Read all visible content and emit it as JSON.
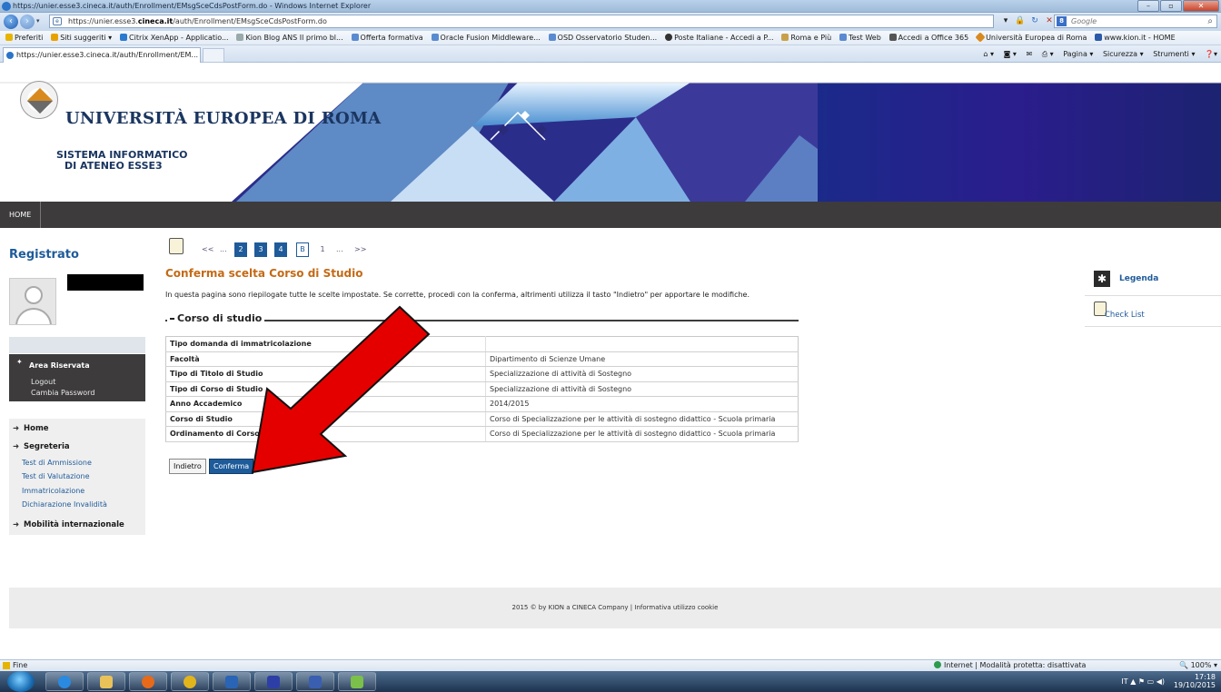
{
  "window": {
    "title": "https://unier.esse3.cineca.it/auth/Enrollment/EMsgSceCdsPostForm.do - Windows Internet Explorer",
    "buttons": [
      "–",
      "▫",
      "✕"
    ]
  },
  "address": {
    "url_prefix": "https://unier.esse3.",
    "url_host": "cineca.it",
    "url_rest": "/auth/Enrollment/EMsgSceCdsPostForm.do",
    "search_placeholder": "Google"
  },
  "favorites": {
    "label": "Preferiti",
    "items": [
      "Siti suggeriti ▾",
      "Citrix XenApp - Applicatio...",
      "Kion Blog ANS Il primo bl...",
      "Offerta formativa",
      "Oracle Fusion Middleware...",
      "OSD Osservatorio Studen...",
      "Poste Italiane - Accedi a P...",
      "Roma e Più",
      "Test Web",
      "Accedi a Office 365",
      "Università Europea di Roma",
      "www.kion.it - HOME"
    ]
  },
  "tab": {
    "label": "https://unier.esse3.cineca.it/auth/Enrollment/EM..."
  },
  "commandbar": {
    "items": [
      "Pagina ▾",
      "Sicurezza ▾",
      "Strumenti ▾"
    ]
  },
  "header": {
    "university": "UNIVERSITÀ EUROPEA DI ROMA",
    "system_line1": "SISTEMA INFORMATICO",
    "system_line2": "DI ATENEO ESSE3"
  },
  "topnav": {
    "home": "HOME"
  },
  "sidebar": {
    "registered": "Registrato",
    "area_title": "Area Riservata",
    "area_links": [
      "Logout",
      "Cambia Password"
    ],
    "menu": [
      {
        "label": "Home",
        "links": []
      },
      {
        "label": "Segreteria",
        "links": [
          "Test di Ammissione",
          "Test di Valutazione",
          "Immatricolazione",
          "Dichiarazione Invalidità"
        ]
      },
      {
        "label": "Mobilità internazionale",
        "links": []
      }
    ]
  },
  "steps": [
    "<<",
    "...",
    "2",
    "3",
    "4",
    "B",
    "1",
    "...",
    ">>"
  ],
  "main": {
    "title": "Conferma scelta Corso di Studio",
    "intro": "In questa pagina sono riepilogate tutte le scelte impostate. Se corrette, procedi con la conferma, altrimenti utilizza il tasto \"Indietro\" per apportare le modifiche.",
    "section": "Corso di studio",
    "rows": [
      {
        "key": "Tipo domanda di immatricolazione",
        "value": ""
      },
      {
        "key": "Facoltà",
        "value": "Dipartimento di Scienze Umane"
      },
      {
        "key": "Tipo di Titolo di Studio",
        "value": "Specializzazione di attività di Sostegno"
      },
      {
        "key": "Tipo di Corso di Studio",
        "value": "Specializzazione di attività di Sostegno"
      },
      {
        "key": "Anno Accademico",
        "value": "2014/2015"
      },
      {
        "key": "Corso di Studio",
        "value": "Corso di Specializzazione per le attività di sostegno didattico - Scuola primaria"
      },
      {
        "key": "Ordinamento di Corso",
        "value": "Corso di Specializzazione per le attività di sostegno didattico - Scuola primaria"
      }
    ],
    "back_label": "Indietro",
    "confirm_label": "Conferma"
  },
  "right": {
    "legenda": "Legenda",
    "checklist": "Check List"
  },
  "footer": {
    "text": "2015 © by KION a CINECA Company | Informativa utilizzo cookie"
  },
  "statusbar": {
    "status": "Fine",
    "zone": "Internet | Modalità protetta: disattivata",
    "zoom": "100%"
  },
  "tray": {
    "lang": "IT",
    "time": "17:18",
    "date": "19/10/2015"
  },
  "colors": {
    "accent_blue": "#1e5b9a",
    "title_orange": "#c46a16",
    "dark_bar": "#3d3b3b",
    "banner_navy": "#27208a",
    "arrow_red": "#e50000"
  }
}
